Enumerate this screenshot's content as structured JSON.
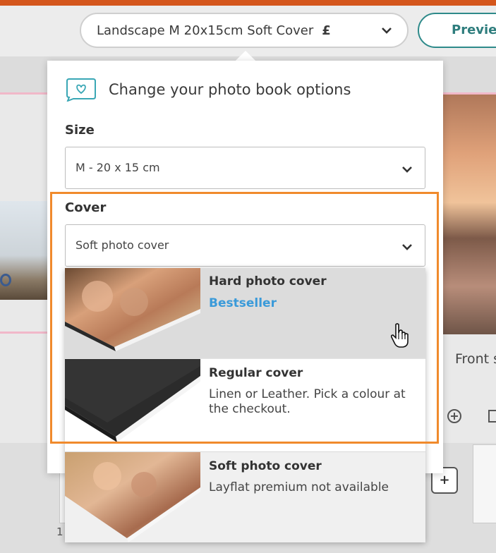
{
  "header": {
    "product_select_value": "Landscape M 20x15cm Soft Cover",
    "currency_symbol": "£",
    "preview_label": "Preview"
  },
  "background": {
    "front_label": "Front s",
    "page_number": "1"
  },
  "panel": {
    "title": "Change your photo book options",
    "size_label": "Size",
    "size_value": "M - 20 x 15 cm",
    "cover_label": "Cover",
    "cover_value": "Soft photo cover"
  },
  "cover_options": [
    {
      "title": "Hard photo cover",
      "badge": "Bestseller",
      "icon": "hard-cover-photo"
    },
    {
      "title": "Regular cover",
      "subtitle": "Linen or Leather. Pick a colour at the checkout.",
      "icon": "regular-cover-photo",
      "colours": [
        "#3a2f7f",
        "#8f1f66",
        "#c8141e",
        "#d2d2d2",
        "#c2b6a0",
        "#f24b0c",
        "#050505",
        "#8c4a10",
        "#050505"
      ]
    },
    {
      "title": "Soft photo cover",
      "subtitle": "Layflat premium not available",
      "icon": "soft-cover-photo"
    }
  ],
  "colors": {
    "accent_teal": "#2e8a8a",
    "highlight_orange": "#f08a2c",
    "bestseller_blue": "#3a9ad9",
    "hover_grey": "#dcdcdc"
  }
}
